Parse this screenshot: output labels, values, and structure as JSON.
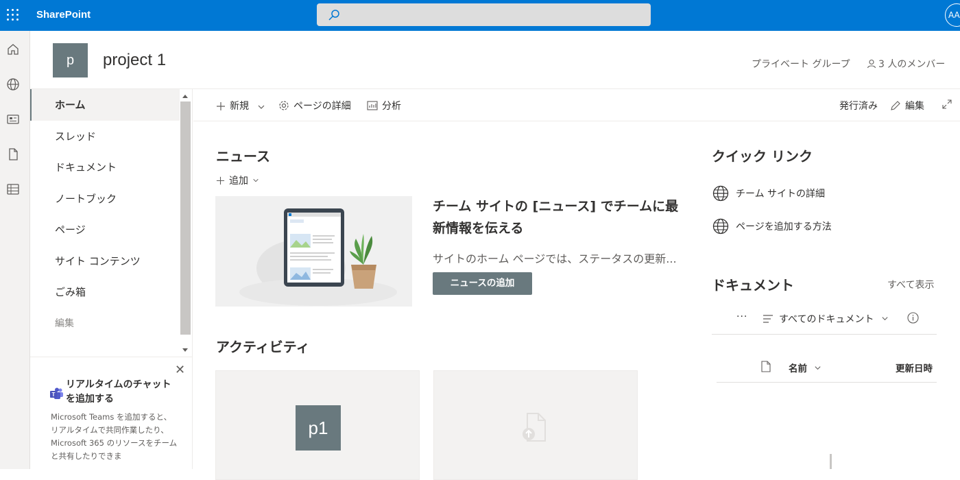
{
  "app": {
    "name": "SharePoint",
    "user_initials": "AA"
  },
  "site": {
    "logo_letter": "p",
    "title": "project 1",
    "group_type": "プライベート グループ",
    "members": "3 人のメンバー"
  },
  "nav": {
    "items": [
      {
        "label": "ホーム",
        "active": true
      },
      {
        "label": "スレッド"
      },
      {
        "label": "ドキュメント"
      },
      {
        "label": "ノートブック"
      },
      {
        "label": "ページ"
      },
      {
        "label": "サイト コンテンツ"
      },
      {
        "label": "ごみ箱"
      }
    ],
    "edit_label": "編集"
  },
  "teams_card": {
    "title": "リアルタイムのチャットを追加する",
    "description": "Microsoft Teams を追加すると、リアルタイムで共同作業したり、Microsoft 365 のリソースをチームと共有したりできま"
  },
  "commandbar": {
    "new": "新規",
    "page_details": "ページの詳細",
    "analytics": "分析",
    "status": "発行済み",
    "edit": "編集"
  },
  "news": {
    "title": "ニュース",
    "add": "追加",
    "headline": "チーム サイトの [ニュース] でチームに最新情報を伝える",
    "description": "サイトのホーム ページでは、ステータスの更新...",
    "button": "ニュースの追加"
  },
  "activity": {
    "title": "アクティビティ",
    "cards": [
      {
        "thumb": "p1"
      },
      {
        "icon": "file-upload-icon"
      }
    ]
  },
  "quick_links": {
    "title": "クイック リンク",
    "items": [
      "チーム サイトの詳細",
      "ページを追加する方法"
    ]
  },
  "documents": {
    "title": "ドキュメント",
    "see_all": "すべて表示",
    "view": "すべてのドキュメント",
    "col_name": "名前",
    "col_modified": "更新日時"
  },
  "colors": {
    "brand": "#0078d4",
    "accent": "#69797e"
  }
}
